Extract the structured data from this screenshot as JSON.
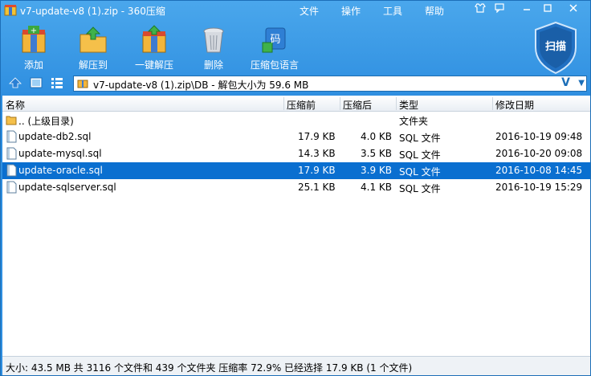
{
  "window": {
    "title": "v7-update-v8 (1).zip - 360压缩"
  },
  "menu": {
    "file": "文件",
    "actions": "操作",
    "tools": "工具",
    "help": "帮助"
  },
  "toolbar": {
    "add": "添加",
    "extract_to": "解压到",
    "one_click_extract": "一键解压",
    "delete": "删除",
    "password": "压缩包语言",
    "scan": "扫描",
    "password_icon_char": "码"
  },
  "address": {
    "path": "v7-update-v8 (1).zip\\DB - 解包大小为 59.6 MB",
    "view_glyph": "V"
  },
  "columns": {
    "name": "名称",
    "compressed": "压缩前",
    "packed": "压缩后",
    "type": "类型",
    "modified": "修改日期"
  },
  "files": [
    {
      "name": ".. (上级目录)",
      "size": "",
      "packed": "",
      "type": "文件夹",
      "date": "",
      "icon": "folder-icon"
    },
    {
      "name": "update-db2.sql",
      "size": "17.9 KB",
      "packed": "4.0 KB",
      "type": "SQL 文件",
      "date": "2016-10-19 09:48",
      "icon": "file-icon"
    },
    {
      "name": "update-mysql.sql",
      "size": "14.3 KB",
      "packed": "3.5 KB",
      "type": "SQL 文件",
      "date": "2016-10-20 09:08",
      "icon": "file-icon"
    },
    {
      "name": "update-oracle.sql",
      "size": "17.9 KB",
      "packed": "3.9 KB",
      "type": "SQL 文件",
      "date": "2016-10-08 14:45",
      "icon": "file-icon",
      "selected": true
    },
    {
      "name": "update-sqlserver.sql",
      "size": "25.1 KB",
      "packed": "4.1 KB",
      "type": "SQL 文件",
      "date": "2016-10-19 15:29",
      "icon": "file-icon"
    }
  ],
  "status": {
    "text": "大小: 43.5 MB 共 3116 个文件和 439 个文件夹 压缩率 72.9% 已经选择 17.9 KB (1 个文件)"
  },
  "colors": {
    "titlebar": "#3c9be8",
    "selection": "#0a6fd0"
  }
}
